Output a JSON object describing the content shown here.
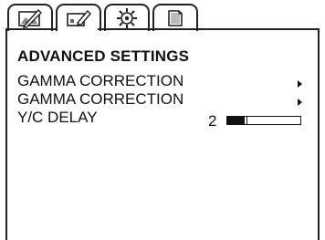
{
  "tabs": [
    {
      "icon": "picture-pen-icon"
    },
    {
      "icon": "image-edit-icon"
    },
    {
      "icon": "gear-icon"
    },
    {
      "icon": "page-icon"
    }
  ],
  "menu": {
    "title": "ADVANCED SETTINGS",
    "items": [
      {
        "label": "GAMMA CORRECTION",
        "has_submenu": true
      },
      {
        "label": "GAMMA CORRECTION",
        "has_submenu": true
      },
      {
        "label": "Y/C DELAY",
        "value": "2",
        "level_fraction": 0.25
      }
    ]
  }
}
